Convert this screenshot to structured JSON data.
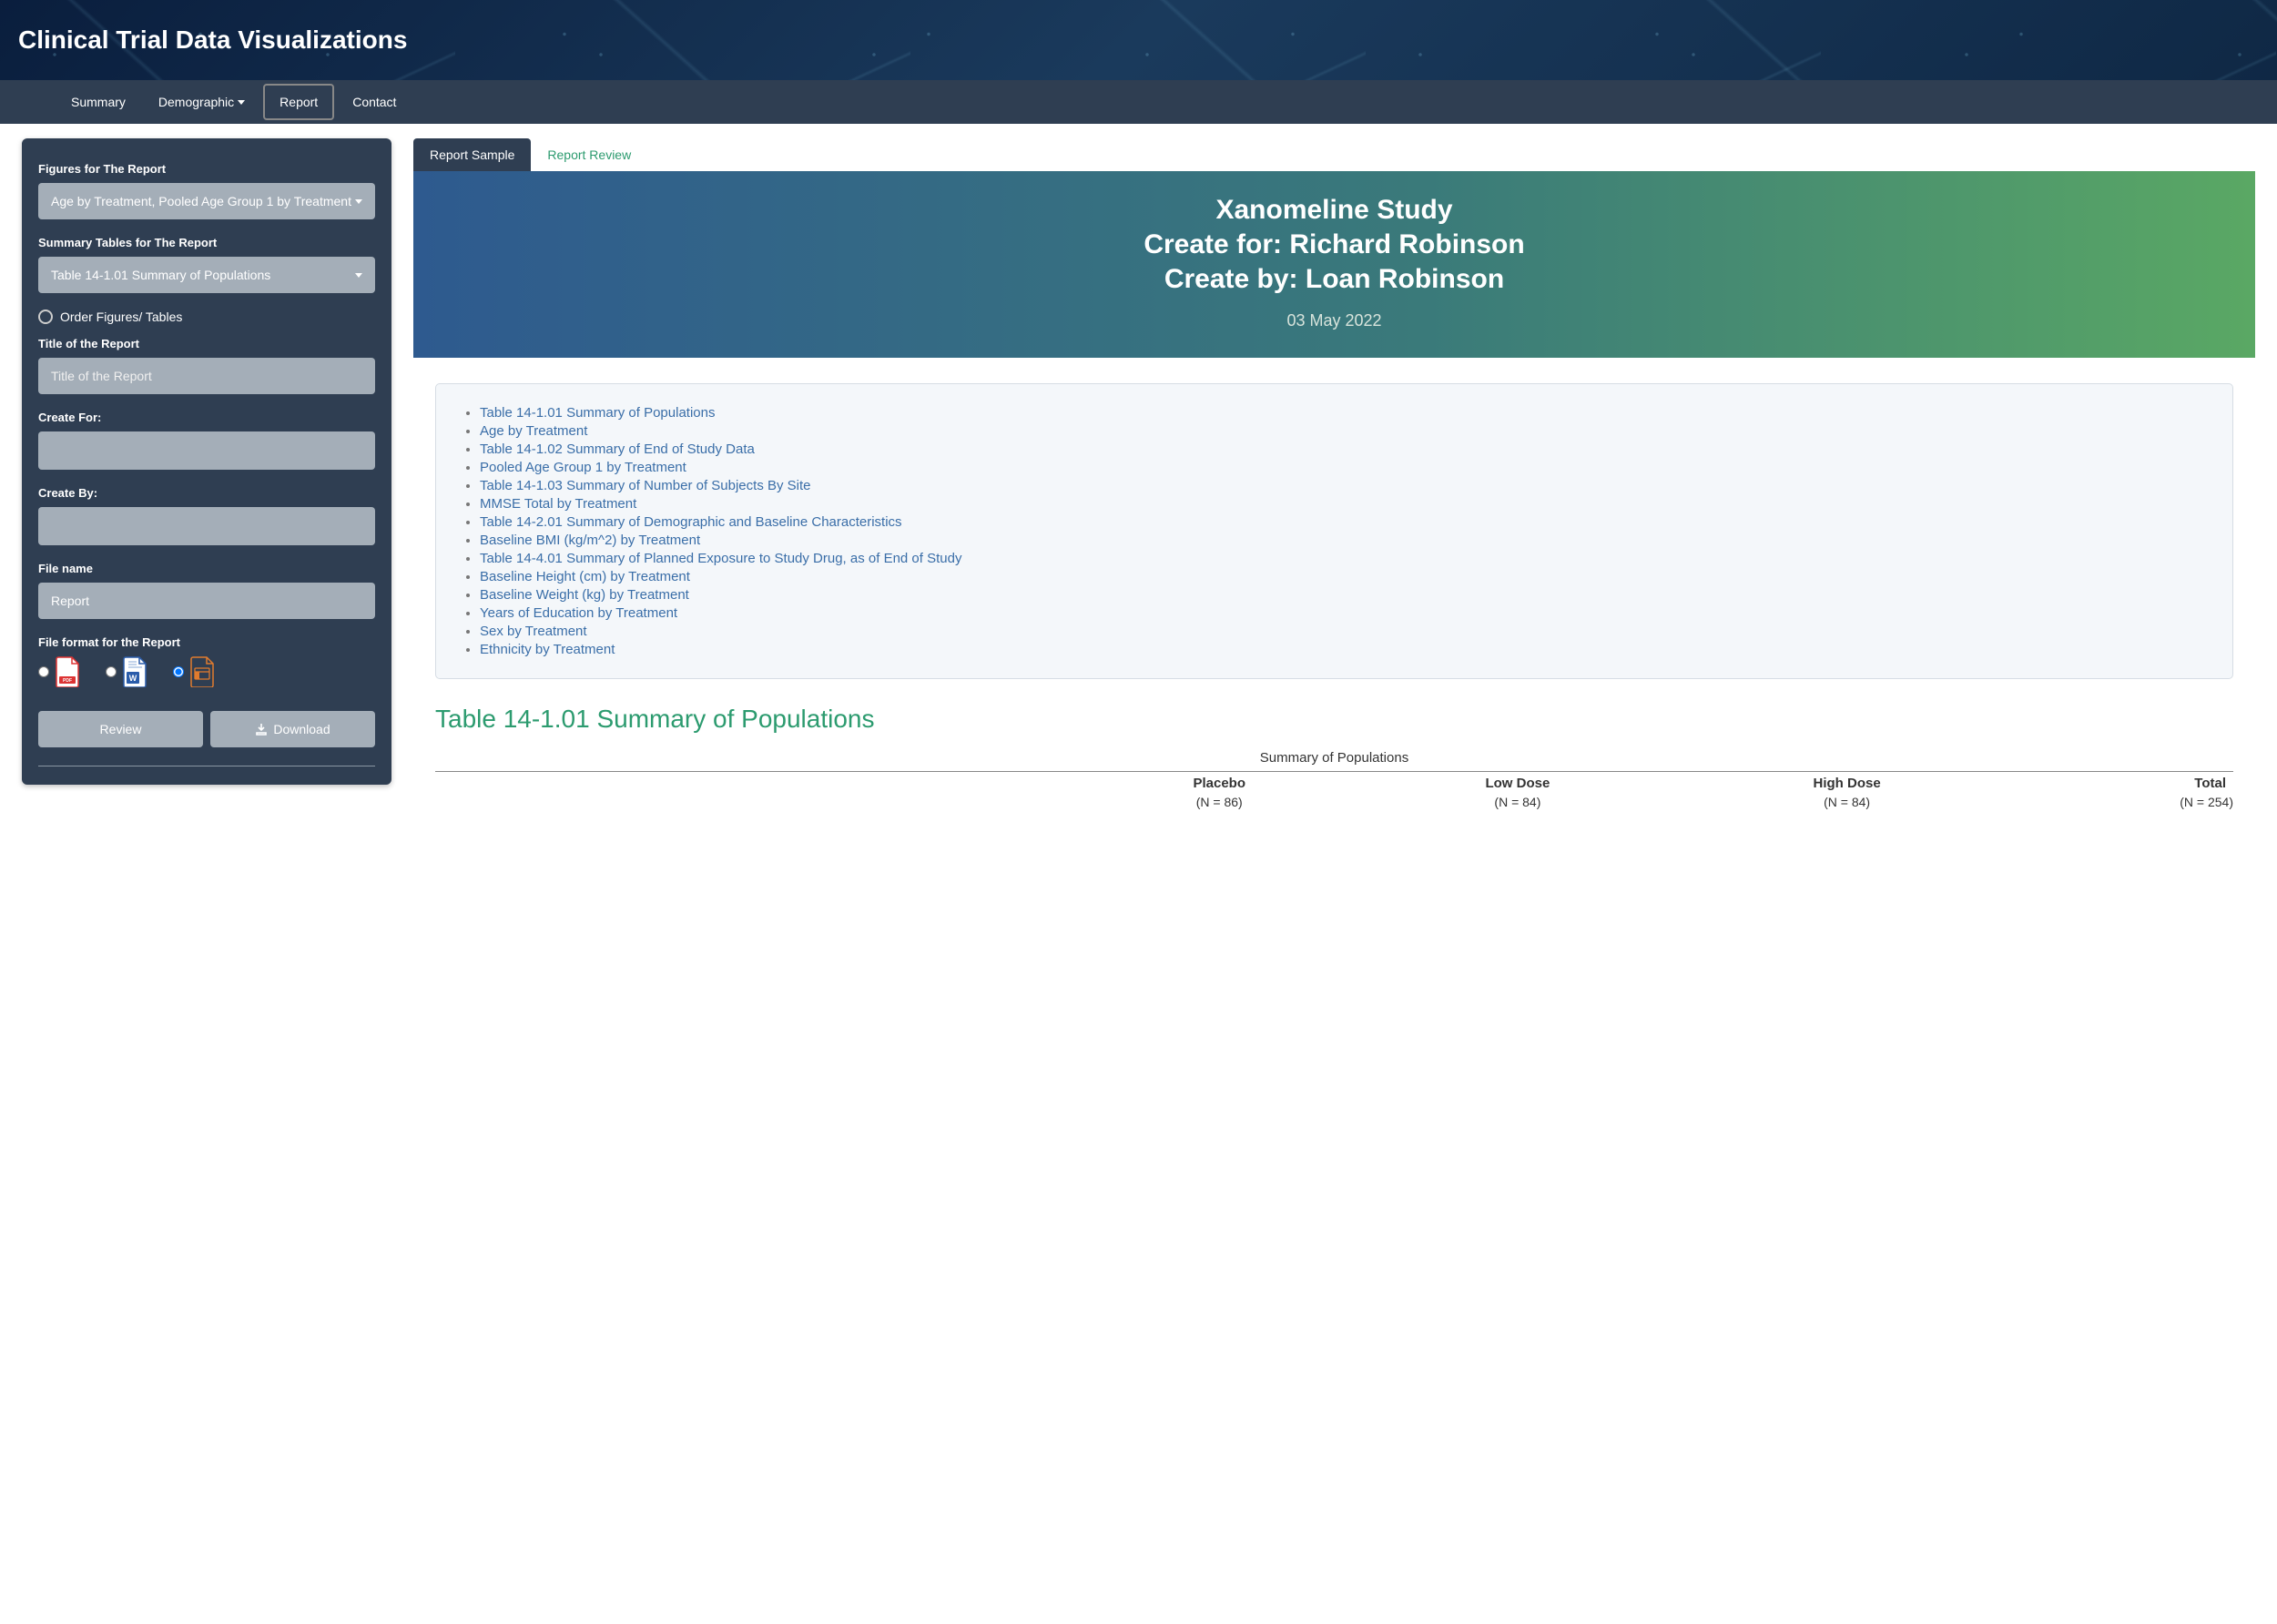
{
  "header": {
    "title": "Clinical Trial Data Visualizations"
  },
  "nav": {
    "summary": "Summary",
    "demographic": "Demographic",
    "report": "Report",
    "contact": "Contact"
  },
  "sidebar": {
    "figures_label": "Figures for The Report",
    "figures_value": "Age by Treatment, Pooled Age Group 1 by Treatment",
    "summary_tables_label": "Summary Tables for The Report",
    "summary_tables_value": "Table 14-1.01 Summary of Populations",
    "order_toggle_label": "Order Figures/ Tables",
    "title_label": "Title of the Report",
    "title_placeholder": "Title of the Report",
    "create_for_label": "Create For:",
    "create_for_value": "",
    "create_by_label": "Create By:",
    "create_by_value": "",
    "filename_label": "File name",
    "filename_value": "Report",
    "fileformat_label": "File format for the Report",
    "review_btn": "Review",
    "download_btn": "Download"
  },
  "tabs": {
    "sample": "Report Sample",
    "review": "Report Review"
  },
  "report_header": {
    "line1": "Xanomeline Study",
    "line2": "Create for: Richard Robinson",
    "line3": "Create by: Loan Robinson",
    "date": "03 May 2022"
  },
  "toc": [
    "Table 14-1.01 Summary of Populations",
    "Age by Treatment",
    "Table 14-1.02 Summary of End of Study Data",
    "Pooled Age Group 1 by Treatment",
    "Table 14-1.03 Summary of Number of Subjects By Site",
    "MMSE Total by Treatment",
    "Table 14-2.01 Summary of Demographic and Baseline Characteristics",
    "Baseline BMI (kg/m^2) by Treatment",
    "Table 14-4.01 Summary of Planned Exposure to Study Drug, as of End of Study",
    "Baseline Height (cm) by Treatment",
    "Baseline Weight (kg) by Treatment",
    "Years of Education by Treatment",
    "Sex by Treatment",
    "Ethnicity by Treatment"
  ],
  "section": {
    "title": "Table 14-1.01 Summary of Populations"
  },
  "table": {
    "caption": "Summary of Populations",
    "cols": [
      {
        "name": "Placebo",
        "n": "(N = 86)"
      },
      {
        "name": "Low Dose",
        "n": "(N = 84)"
      },
      {
        "name": "High Dose",
        "n": "(N = 84)"
      },
      {
        "name": "Total",
        "n": "(N = 254)"
      }
    ]
  }
}
